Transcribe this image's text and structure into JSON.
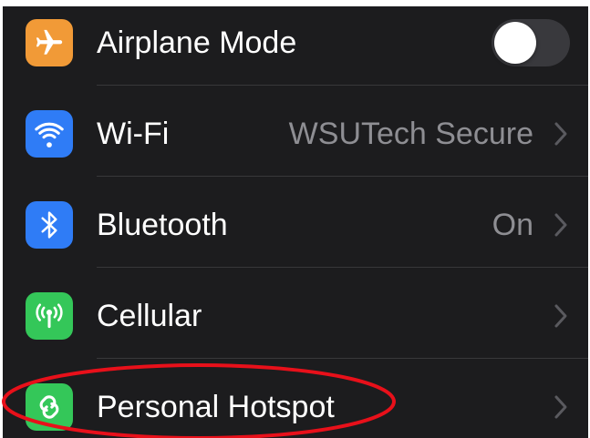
{
  "settings": {
    "rows": [
      {
        "id": "airplane",
        "label": "Airplane Mode",
        "icon": "airplane-icon",
        "icon_color": "#f19a37",
        "toggle_on": false
      },
      {
        "id": "wifi",
        "label": "Wi-Fi",
        "value": "WSUTech Secure",
        "icon": "wifi-icon",
        "icon_color": "#2f7cf6"
      },
      {
        "id": "bluetooth",
        "label": "Bluetooth",
        "value": "On",
        "icon": "bluetooth-icon",
        "icon_color": "#2f7cf6"
      },
      {
        "id": "cellular",
        "label": "Cellular",
        "icon": "cellular-antenna-icon",
        "icon_color": "#34c759"
      },
      {
        "id": "hotspot",
        "label": "Personal Hotspot",
        "icon": "hotspot-link-icon",
        "icon_color": "#34c759"
      }
    ]
  },
  "colors": {
    "background": "#1c1c1e",
    "separator": "#38383a",
    "secondary_text": "#8e8e93",
    "annotation_circle": "#e8101a"
  }
}
